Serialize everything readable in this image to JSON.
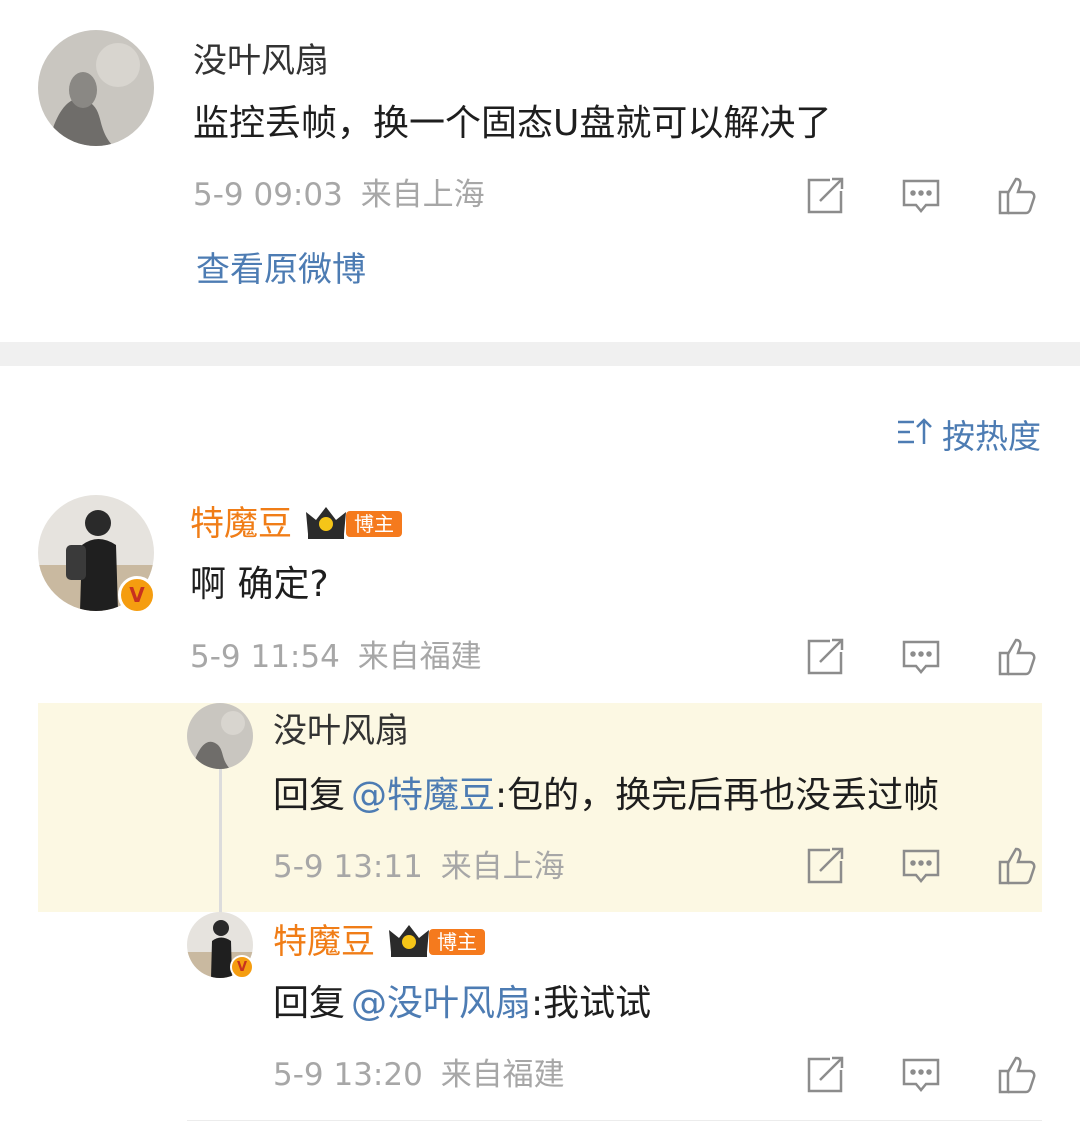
{
  "top_comment": {
    "username": "没叶风扇",
    "text": "监控丢帧，换一个固态U盘就可以解决了",
    "timestamp": "5-9 09:03",
    "location": "来自上海",
    "view_original": "查看原微博"
  },
  "sort": {
    "label": "按热度"
  },
  "comment": {
    "username": "特魔豆",
    "badge": "博主",
    "text": "啊 确定?",
    "timestamp": "5-9 11:54",
    "location": "来自福建"
  },
  "replies": [
    {
      "username": "没叶风扇",
      "reply_prefix": "回复",
      "mention": "@特魔豆",
      "text": ":包的，换完后再也没丢过帧",
      "timestamp": "5-9 13:11",
      "location": "来自上海",
      "highlight_color": "#fcf8e3"
    },
    {
      "username": "特魔豆",
      "badge": "博主",
      "reply_prefix": "回复",
      "mention": "@没叶风扇",
      "text": ":我试试",
      "timestamp": "5-9 13:20",
      "location": "来自福建"
    }
  ],
  "icons": [
    "share-icon",
    "comment-icon",
    "like-icon",
    "sort-icon",
    "crown-icon",
    "verified-v-icon"
  ],
  "colors": {
    "orange_name": "#f07d17",
    "link": "#4d7cb3",
    "meta": "#a7a7a7",
    "divider": "#f0f0f0"
  }
}
